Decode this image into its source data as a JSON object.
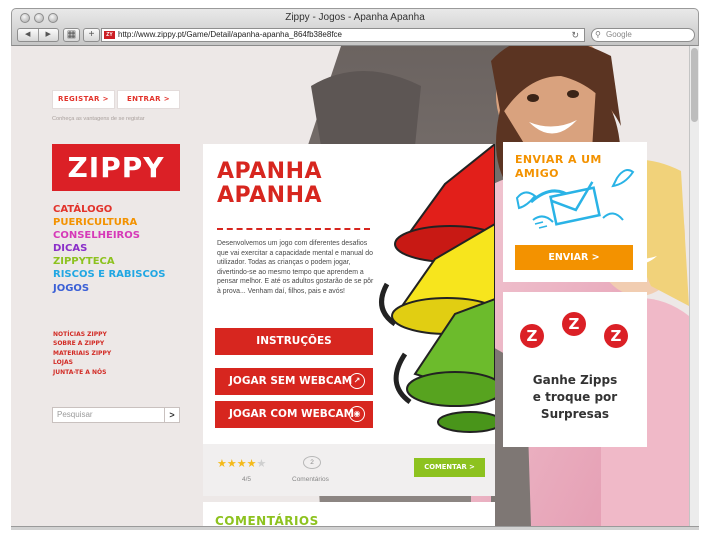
{
  "window": {
    "title": "Zippy - Jogos - Apanha Apanha",
    "url": "http://www.zippy.pt/Game/Detail/apanha-apanha_864fb38e8fce",
    "search_placeholder": "Google",
    "favicon_text": "ZY"
  },
  "account": {
    "register_label": "REGISTAR >",
    "login_label": "ENTRAR >",
    "hint": "Conheça as vantagens de se registar"
  },
  "logo": "ZIPPY",
  "menu": {
    "main": [
      {
        "label": "CATÁLOGO",
        "color": "#e2332b"
      },
      {
        "label": "PUERICULTURA",
        "color": "#f39200"
      },
      {
        "label": "CONSELHEIROS",
        "color": "#d639b8"
      },
      {
        "label": "DICAS",
        "color": "#8a2ec9"
      },
      {
        "label": "ZIPPYTECA",
        "color": "#8dc21f"
      },
      {
        "label": "RISCOS E RABISCOS",
        "color": "#21a7e3"
      },
      {
        "label": "JOGOS",
        "color": "#3a5fd6"
      }
    ],
    "secondary": [
      "NOTÍCIAS ZIPPY",
      "SOBRE A ZIPPY",
      "MATERIAIS ZIPPY",
      "LOJAS",
      "JUNTA-TE A NÓS"
    ]
  },
  "site_search": {
    "placeholder": "Pesquisar",
    "button": ">"
  },
  "game": {
    "title_line1": "APANHA",
    "title_line2": "APANHA",
    "description": "Desenvolvemos um jogo com diferentes desafios que vai exercitar a capacidade mental e manual do utilizador. Todas as crianças o podem jogar, divertindo-se ao mesmo tempo que aprendem a pensar melhor. E até os adultos gostarão de se pôr à prova... Venham daí, filhos, pais e avós!",
    "instructions_label": "INSTRUÇÕES",
    "play_no_cam_label": "JOGAR SEM WEBCAM",
    "play_cam_label": "JOGAR COM WEBCAM",
    "rating": 4,
    "rating_max": 5,
    "rating_text": "4/5",
    "comment_count": "2",
    "comments_label": "Comentários",
    "comment_button": "COMENTAR >"
  },
  "comments_section_title": "COMENTÁRIOS",
  "friend_panel": {
    "title_line1": "ENVIAR A UM",
    "title_line2": "AMIGO",
    "send_label": "ENVIAR >"
  },
  "zipps_panel": {
    "letters": [
      "Z",
      "Z",
      "Z"
    ],
    "text_line1": "Ganhe Zipps",
    "text_line2": "e troque por",
    "text_line3": "Surpresas"
  },
  "colors": {
    "brand_red": "#db2026",
    "orange": "#f39200",
    "green": "#8dc21f"
  }
}
